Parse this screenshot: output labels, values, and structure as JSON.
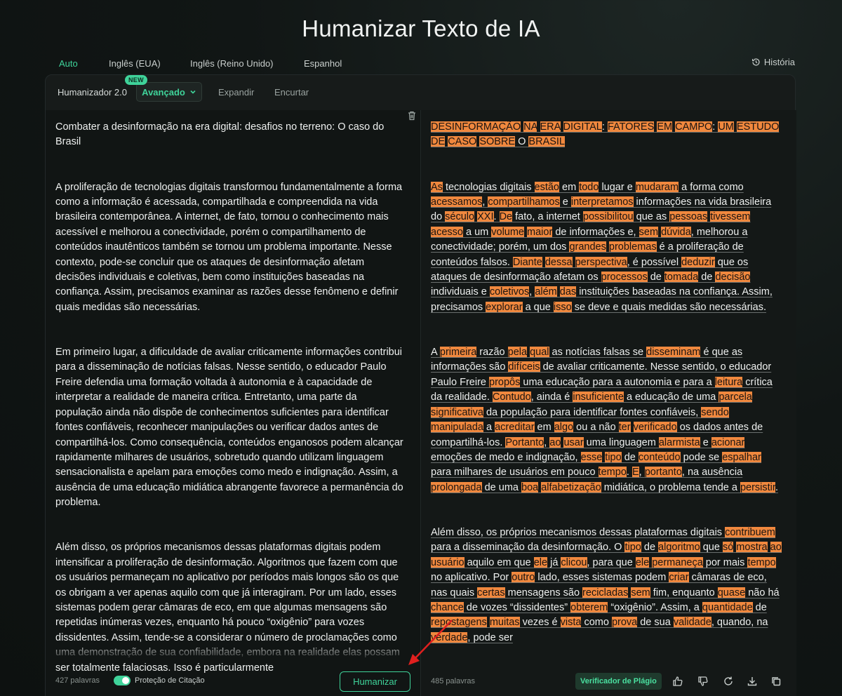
{
  "page_title": "Humanizar Texto de IA",
  "lang_tabs": [
    "Auto",
    "Inglês (EUA)",
    "Inglês (Reino Unido)",
    "Espanhol"
  ],
  "history_label": "História",
  "toolbar": {
    "humanizer_label": "Humanizador 2.0",
    "new_badge": "NEW",
    "mode": "Avançado",
    "expand": "Expandir",
    "shorten": "Encurtar"
  },
  "input": {
    "paragraphs": [
      "Combater a desinformação na era digital: desafios no terreno: O caso do Brasil",
      "A proliferação de tecnologias digitais transformou fundamentalmente a forma como a informação é acessada, compartilhada e compreendida na vida brasileira contemporânea. A internet, de fato, tornou o conhecimento mais acessível e melhorou a conectividade, porém o compartilhamento de conteúdos inautênticos também se tornou um problema importante. Nesse contexto, pode-se concluir que os ataques de desinformação afetam decisões individuais e coletivas, bem como instituições baseadas na confiança. Assim, precisamos examinar as razões desse fenômeno e definir quais medidas são necessárias.",
      "Em primeiro lugar, a dificuldade de avaliar criticamente informações contribui para a disseminação de notícias falsas. Nesse sentido, o educador Paulo Freire defendia uma formação voltada à autonomia e à capacidade de interpretar a realidade de maneira crítica. Entretanto, uma parte da população ainda não dispõe de conhecimentos suficientes para identificar fontes confiáveis, reconhecer manipulações ou verificar dados antes de compartilhá-los. Como consequência, conteúdos enganosos podem alcançar rapidamente milhares de usuários, sobretudo quando utilizam linguagem sensacionalista e apelam para emoções como medo e indignação. Assim, a ausência de uma educação midiática abrangente favorece a permanência do problema.",
      "Além disso, os próprios mecanismos dessas plataformas digitais podem intensificar a proliferação de desinformação. Algoritmos que fazem com que os usuários permaneçam no aplicativo por períodos mais longos são os que os obrigam a ver apenas aquilo com que já interagiram. Por um lado, esses sistemas podem gerar câmaras de eco, em que algumas mensagens são repetidas inúmeras vezes, enquanto há pouco “oxigênio” para vozes dissidentes. Assim, tende-se a considerar o número de proclamações como uma demonstração de sua confiabilidade, embora na realidade elas possam ser totalmente falaciosas. Isso é particularmente"
    ],
    "word_count": "427 palavras",
    "citation_label": "Proteção de Citação",
    "humanize_button": "Humanizar"
  },
  "output": {
    "paragraphs": [
      [
        {
          "t": "DESINFORMAÇÃO",
          "h": true
        },
        {
          "t": " "
        },
        {
          "t": "NA",
          "h": true
        },
        {
          "t": " "
        },
        {
          "t": "ERA",
          "h": true
        },
        {
          "t": " "
        },
        {
          "t": "DIGITAL",
          "h": true
        },
        {
          "t": ": "
        },
        {
          "t": "FATORES",
          "h": true
        },
        {
          "t": " "
        },
        {
          "t": "EM",
          "h": true
        },
        {
          "t": " "
        },
        {
          "t": "CAMPO",
          "h": true
        },
        {
          "t": ": "
        },
        {
          "t": "UM",
          "h": true
        },
        {
          "t": " "
        },
        {
          "t": "ESTUDO",
          "h": true
        },
        {
          "t": " "
        },
        {
          "t": "DE",
          "h": true
        },
        {
          "t": " "
        },
        {
          "t": "CASO",
          "h": true
        },
        {
          "t": " "
        },
        {
          "t": "SOBRE",
          "h": true
        },
        {
          "t": " O "
        },
        {
          "t": "BRASIL",
          "h": true
        }
      ],
      [
        {
          "t": "As",
          "h": true
        },
        {
          "t": " tecnologias digitais "
        },
        {
          "t": "estão",
          "h": true
        },
        {
          "t": " em "
        },
        {
          "t": "todo",
          "h": true
        },
        {
          "t": " lugar e "
        },
        {
          "t": "mudaram",
          "h": true
        },
        {
          "t": " a forma como "
        },
        {
          "t": "acessamos",
          "h": true
        },
        {
          "t": ", "
        },
        {
          "t": "compartilhamos",
          "h": true
        },
        {
          "t": " e "
        },
        {
          "t": "interpretamos",
          "h": true
        },
        {
          "t": " informações na vida brasileira do "
        },
        {
          "t": "século",
          "h": true
        },
        {
          "t": " "
        },
        {
          "t": "XXI",
          "h": true
        },
        {
          "t": ". "
        },
        {
          "t": "De",
          "h": true
        },
        {
          "t": " fato, a internet "
        },
        {
          "t": "possibilitou",
          "h": true
        },
        {
          "t": " que as "
        },
        {
          "t": "pessoas",
          "h": true
        },
        {
          "t": " "
        },
        {
          "t": "tivessem",
          "h": true
        },
        {
          "t": " "
        },
        {
          "t": "acesso",
          "h": true
        },
        {
          "t": " a um "
        },
        {
          "t": "volume",
          "h": true
        },
        {
          "t": " "
        },
        {
          "t": "maior",
          "h": true
        },
        {
          "t": " de informações e, "
        },
        {
          "t": "sem",
          "h": true
        },
        {
          "t": " "
        },
        {
          "t": "dúvida",
          "h": true
        },
        {
          "t": ", melhorou a conectividade; porém, um dos "
        },
        {
          "t": "grandes",
          "h": true
        },
        {
          "t": " "
        },
        {
          "t": "problemas",
          "h": true
        },
        {
          "t": " é a proliferação de conteúdos falsos. "
        },
        {
          "t": "Diante",
          "h": true
        },
        {
          "t": " "
        },
        {
          "t": "dessa",
          "h": true
        },
        {
          "t": " "
        },
        {
          "t": "perspectiva",
          "h": true
        },
        {
          "t": ", é possível "
        },
        {
          "t": "deduzir",
          "h": true
        },
        {
          "t": " que os ataques de desinformação afetam os "
        },
        {
          "t": "processos",
          "h": true
        },
        {
          "t": " de "
        },
        {
          "t": "tomada",
          "h": true
        },
        {
          "t": " de "
        },
        {
          "t": "decisão",
          "h": true
        },
        {
          "t": " individuais e "
        },
        {
          "t": "coletivos",
          "h": true
        },
        {
          "t": ", "
        },
        {
          "t": "além",
          "h": true
        },
        {
          "t": " "
        },
        {
          "t": "das",
          "h": true
        },
        {
          "t": " instituições baseadas na confiança. Assim, precisamos "
        },
        {
          "t": "explorar",
          "h": true
        },
        {
          "t": " a que "
        },
        {
          "t": "isso",
          "h": true
        },
        {
          "t": " se deve e quais medidas são necessárias."
        }
      ],
      [
        {
          "t": "A "
        },
        {
          "t": "primeira",
          "h": true
        },
        {
          "t": " razão "
        },
        {
          "t": "pela",
          "h": true
        },
        {
          "t": " "
        },
        {
          "t": "qual",
          "h": true
        },
        {
          "t": " as notícias falsas se "
        },
        {
          "t": "disseminam",
          "h": true
        },
        {
          "t": " é que as informações são "
        },
        {
          "t": "difíceis",
          "h": true
        },
        {
          "t": " de avaliar criticamente. Nesse sentido, o educador Paulo Freire "
        },
        {
          "t": "propôs",
          "h": true
        },
        {
          "t": " uma educação para a autonomia e para a "
        },
        {
          "t": "leitura",
          "h": true
        },
        {
          "t": " crítica da realidade. "
        },
        {
          "t": "Contudo",
          "h": true
        },
        {
          "t": ", ainda é "
        },
        {
          "t": "insuficiente",
          "h": true
        },
        {
          "t": " a educação de uma "
        },
        {
          "t": "parcela",
          "h": true
        },
        {
          "t": " "
        },
        {
          "t": "significativa",
          "h": true
        },
        {
          "t": " da população para identificar fontes confiáveis, "
        },
        {
          "t": "sendo",
          "h": true
        },
        {
          "t": " "
        },
        {
          "t": "manipulada",
          "h": true
        },
        {
          "t": " a "
        },
        {
          "t": "acreditar",
          "h": true
        },
        {
          "t": " em "
        },
        {
          "t": "algo",
          "h": true
        },
        {
          "t": " ou a não "
        },
        {
          "t": "ter",
          "h": true
        },
        {
          "t": " "
        },
        {
          "t": "verificado",
          "h": true
        },
        {
          "t": " os dados antes de compartilhá-los. "
        },
        {
          "t": "Portanto",
          "h": true
        },
        {
          "t": ", "
        },
        {
          "t": "ao",
          "h": true
        },
        {
          "t": " "
        },
        {
          "t": "usar",
          "h": true
        },
        {
          "t": " uma linguagem "
        },
        {
          "t": "alarmista",
          "h": true
        },
        {
          "t": " e "
        },
        {
          "t": "acionar",
          "h": true
        },
        {
          "t": " emoções de medo e indignação, "
        },
        {
          "t": "esse",
          "h": true
        },
        {
          "t": " "
        },
        {
          "t": "tipo",
          "h": true
        },
        {
          "t": " de "
        },
        {
          "t": "conteúdo",
          "h": true
        },
        {
          "t": " pode se "
        },
        {
          "t": "espalhar",
          "h": true
        },
        {
          "t": " para milhares de usuários em pouco "
        },
        {
          "t": "tempo",
          "h": true
        },
        {
          "t": ". "
        },
        {
          "t": "E",
          "h": true
        },
        {
          "t": ", "
        },
        {
          "t": "portanto",
          "h": true
        },
        {
          "t": ", na ausência "
        },
        {
          "t": "prolongada",
          "h": true
        },
        {
          "t": " de uma "
        },
        {
          "t": "boa",
          "h": true
        },
        {
          "t": " "
        },
        {
          "t": "alfabetização",
          "h": true
        },
        {
          "t": " midiática, o problema tende a "
        },
        {
          "t": "persistir",
          "h": true
        },
        {
          "t": "."
        }
      ],
      [
        {
          "t": "Além disso, os próprios mecanismos dessas plataformas digitais "
        },
        {
          "t": "contribuem",
          "h": true
        },
        {
          "t": " para a disseminação da desinformação. O "
        },
        {
          "t": "tipo",
          "h": true
        },
        {
          "t": " de "
        },
        {
          "t": "algoritmo",
          "h": true
        },
        {
          "t": " que "
        },
        {
          "t": "só",
          "h": true
        },
        {
          "t": " "
        },
        {
          "t": "mostra",
          "h": true
        },
        {
          "t": " "
        },
        {
          "t": "ao",
          "h": true
        },
        {
          "t": " "
        },
        {
          "t": "usuário",
          "h": true
        },
        {
          "t": " aquilo em que "
        },
        {
          "t": "ele",
          "h": true
        },
        {
          "t": " já "
        },
        {
          "t": "clicou",
          "h": true
        },
        {
          "t": ", para que "
        },
        {
          "t": "ele",
          "h": true
        },
        {
          "t": " "
        },
        {
          "t": "permaneça",
          "h": true
        },
        {
          "t": " por mais "
        },
        {
          "t": "tempo",
          "h": true
        },
        {
          "t": " no aplicativo. Por "
        },
        {
          "t": "outro",
          "h": true
        },
        {
          "t": " lado, esses sistemas podem "
        },
        {
          "t": "criar",
          "h": true
        },
        {
          "t": " câmaras de eco, nas quais "
        },
        {
          "t": "certas",
          "h": true
        },
        {
          "t": " mensagens são "
        },
        {
          "t": "recicladas",
          "h": true
        },
        {
          "t": " "
        },
        {
          "t": "sem",
          "h": true
        },
        {
          "t": " fim, enquanto "
        },
        {
          "t": "quase",
          "h": true
        },
        {
          "t": " não há "
        },
        {
          "t": "chance",
          "h": true
        },
        {
          "t": " de vozes “dissidentes” "
        },
        {
          "t": "obterem",
          "h": true
        },
        {
          "t": " “oxigênio”. Assim, a "
        },
        {
          "t": "quantidade",
          "h": true
        },
        {
          "t": " de "
        },
        {
          "t": "repostagens",
          "h": true
        },
        {
          "t": " "
        },
        {
          "t": "muitas",
          "h": true
        },
        {
          "t": " vezes é "
        },
        {
          "t": "vista",
          "h": true
        },
        {
          "t": " como "
        },
        {
          "t": "prova",
          "h": true
        },
        {
          "t": " de sua "
        },
        {
          "t": "validade",
          "h": true
        },
        {
          "t": ", quando, na "
        },
        {
          "t": "verdade",
          "h": true
        },
        {
          "t": ", pode ser"
        }
      ]
    ],
    "word_count": "485 palavras",
    "plagiarism_button": "Verificador de Plágio",
    "actions": [
      "thumbs-up-icon",
      "thumbs-down-icon",
      "refresh-icon",
      "download-icon",
      "copy-icon"
    ]
  },
  "colors": {
    "accent": "#3fd39a",
    "highlight": "#f0883e",
    "annotation_arrow": "#e0201f"
  }
}
